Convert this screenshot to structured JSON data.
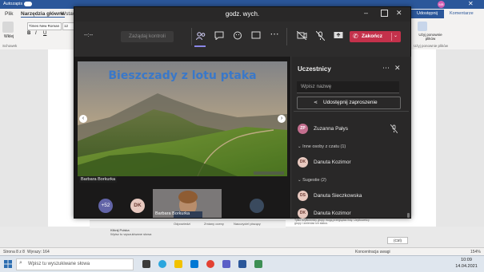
{
  "word": {
    "autosave": "Autozapis",
    "tabs": [
      "Plik",
      "Narzędzia główne",
      "Wstaw"
    ],
    "share_label": "Udostępnij",
    "comments_label": "Komentarze",
    "font_name": "Times New Roman",
    "font_size": "12",
    "paste_label": "Wklej",
    "clipboard_label": "Schowek",
    "reuse_files_label": "Użyj ponownie plików",
    "reuse_files_group": "Użyj ponownie plików",
    "page_status": "Strona 8 z 8",
    "words_status": "Wyrazy: 164",
    "focus_label": "Koncentracja uwagi",
    "zoom": "154%",
    "snippet": "Tylko użytkownicy grupy mogą przeglądać listy. Uzytkownicy grupy i zmieniać ich status.",
    "ctrl_label": "(Ctrl)",
    "app_items": [
      "Odpowiedzi",
      "Zmiany oceny",
      "Nauczyciel piszący"
    ],
    "doc_items": [
      "Kliknij Polska",
      "Wpisz tu wyszukiwane słowa"
    ],
    "user_initials": "MB"
  },
  "teams": {
    "title": "godz. wych.",
    "timer": "--:--",
    "request_control": "Zażądaj kontroli",
    "end_label": "Zakończ",
    "presenter_label": "Barbara Borkurka",
    "slide_title": "Bieszczady z lotu ptaka",
    "overflow_count": "+52",
    "tile_initials": "DK",
    "tile_name": "Barbara Borkurka",
    "participants": {
      "header": "Uczestnicy",
      "search_placeholder": "Wpisz nazwę",
      "share_invite": "Udostępnij zaproszenie",
      "top_person": {
        "name": "Zuzanna Pałys",
        "initials": "ZP"
      },
      "section_chat": "Inne osoby z czatu (1)",
      "chat_people": [
        {
          "name": "Danuta Kozimor",
          "initials": "DK"
        }
      ],
      "section_suggested": "Sugestie (2)",
      "suggested_people": [
        {
          "name": "Danuta Sieczkowska",
          "initials": "DS"
        },
        {
          "name": "Danuta Kozimor",
          "initials": "DK"
        }
      ]
    }
  },
  "taskbar": {
    "search_placeholder": "Wpisz tu wyszukiwane słowa",
    "time": "10:09",
    "date": "14.04.2021"
  }
}
